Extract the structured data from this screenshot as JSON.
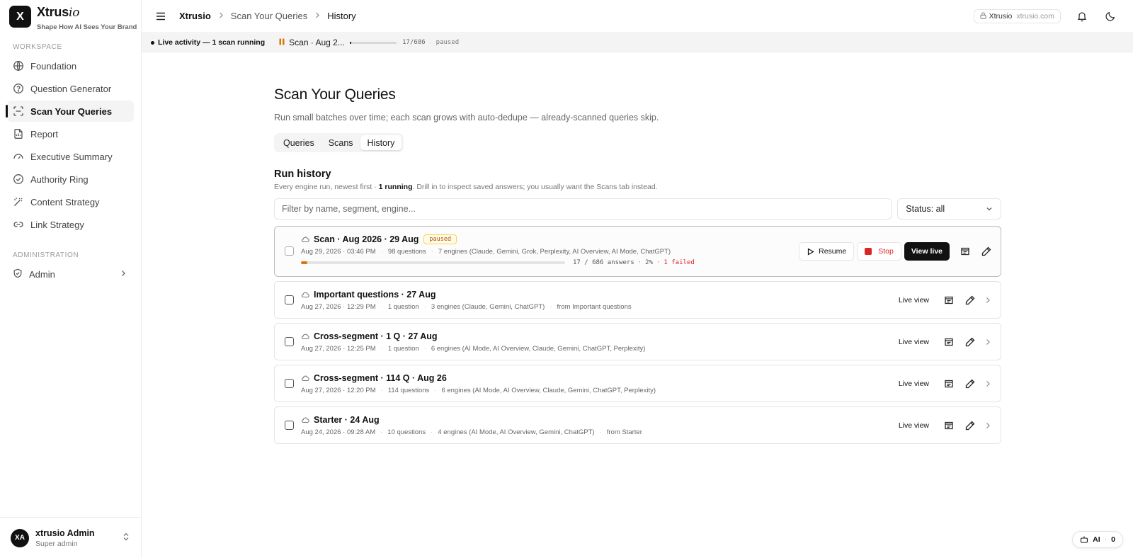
{
  "brand": {
    "logo_letter": "X",
    "name": "Xtrus",
    "name_italic": "io",
    "tagline": "Shape How AI Sees Your Brand"
  },
  "sidebar": {
    "workspace_label": "WORKSPACE",
    "items": [
      {
        "label": "Foundation",
        "icon": "globe-icon"
      },
      {
        "label": "Question Generator",
        "icon": "help-circle-icon"
      },
      {
        "label": "Scan Your Queries",
        "icon": "scan-icon",
        "active": true
      },
      {
        "label": "Report",
        "icon": "file-icon"
      },
      {
        "label": "Executive Summary",
        "icon": "gauge-icon"
      },
      {
        "label": "Authority Ring",
        "icon": "check-circle-icon"
      },
      {
        "label": "Content Strategy",
        "icon": "wand-icon"
      },
      {
        "label": "Link Strategy",
        "icon": "link-icon"
      }
    ],
    "admin_label": "ADMINISTRATION",
    "admin_item": {
      "label": "Admin",
      "icon": "shield-icon"
    },
    "user": {
      "initials": "XA",
      "name": "xtrusio Admin",
      "role": "Super admin"
    }
  },
  "topbar": {
    "breadcrumbs": [
      "Xtrusio",
      "Scan Your Queries",
      "History"
    ],
    "site_name": "Xtrusio",
    "site_domain": "xtrusio.com"
  },
  "activity": {
    "label": "Live activity — 1 scan running",
    "scan_name": "Scan · Aug 2...",
    "progress": 0.025,
    "count": "17/686",
    "status": "paused"
  },
  "page": {
    "title": "Scan Your Queries",
    "subtitle": "Run small batches over time; each scan grows with auto-dedupe — already-scanned queries skip.",
    "tabs": [
      "Queries",
      "Scans",
      "History"
    ],
    "active_tab": "History"
  },
  "history": {
    "title": "Run history",
    "sub_prefix": "Every engine run, newest first · ",
    "sub_running": "1 running",
    "sub_suffix": ". Drill in to inspect saved answers; you usually want the Scans tab instead.",
    "filter_placeholder": "Filter by name, segment, engine...",
    "status_filter": "Status: all"
  },
  "runs": [
    {
      "title": "Scan · Aug 2026 · 29 Aug",
      "badge": "paused",
      "date": "Aug 29, 2026 · 03:46 PM",
      "questions": "98 questions",
      "engines": "7 engines (Claude, Gemini, Grok, Perplexity, AI Overview, AI Mode, ChatGPT)",
      "progress": 0.025,
      "answers": "17 / 686 answers",
      "pct": "2%",
      "failed": "1 failed",
      "actions": {
        "resume": "Resume",
        "stop": "Stop",
        "view_live": "View live"
      }
    },
    {
      "title": "Important questions · 27 Aug",
      "date": "Aug 27, 2026 · 12:29 PM",
      "questions": "1 question",
      "engines": "3 engines (Claude, Gemini, ChatGPT)",
      "source": "from Important questions",
      "live_label": "Live view"
    },
    {
      "title": "Cross-segment · 1 Q · 27 Aug",
      "date": "Aug 27, 2026 · 12:25 PM",
      "questions": "1 question",
      "engines": "6 engines (AI Mode, AI Overview, Claude, Gemini, ChatGPT, Perplexity)",
      "source": "",
      "live_label": "Live view"
    },
    {
      "title": "Cross-segment · 114 Q · Aug 26",
      "date": "Aug 27, 2026 · 12:20 PM",
      "questions": "114 questions",
      "engines": "6 engines (AI Mode, AI Overview, Claude, Gemini, ChatGPT, Perplexity)",
      "source": "",
      "live_label": "Live view"
    },
    {
      "title": "Starter · 24 Aug",
      "date": "Aug 24, 2026 · 09:28 AM",
      "questions": "10 questions",
      "engines": "4 engines (AI Mode, AI Overview, Gemini, ChatGPT)",
      "source": "from Starter",
      "live_label": "Live view"
    }
  ],
  "ai_pill": {
    "label": "AI",
    "count": "0"
  },
  "colors": {
    "accent": "#111111",
    "paused": "#d97706",
    "danger": "#dc2626"
  }
}
